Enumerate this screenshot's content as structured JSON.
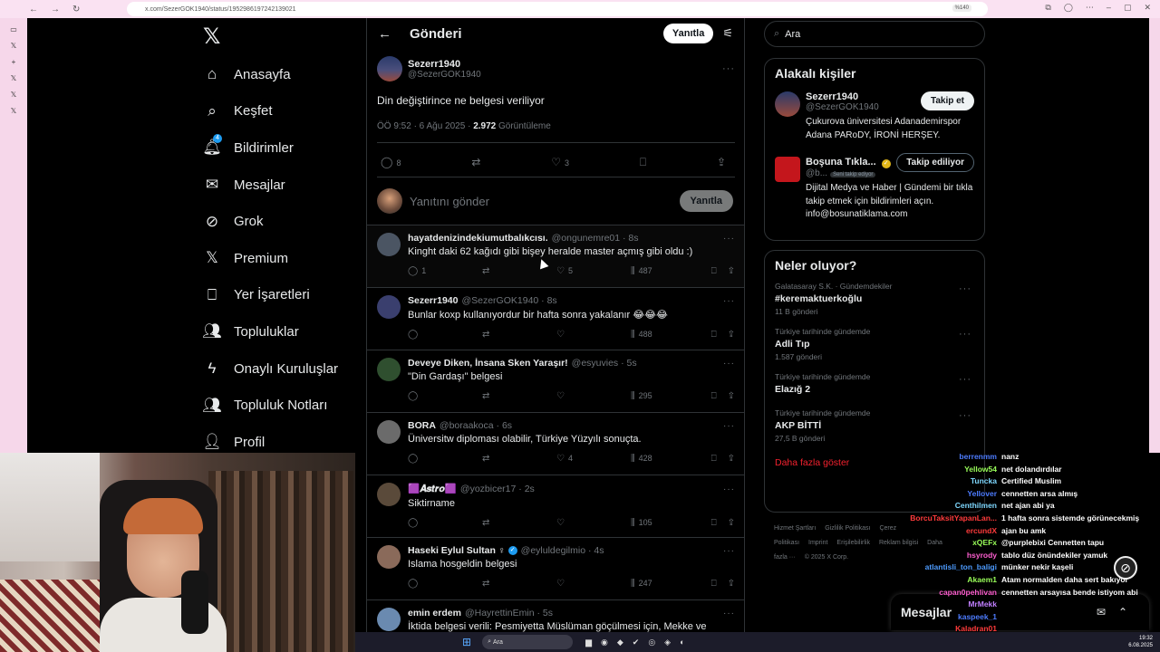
{
  "browser": {
    "url": "x.com/SezerGOK1940/status/1952986197242139021",
    "zoom": "%140"
  },
  "colors": {
    "accent": "#1d9bf0",
    "danger": "#f4212e",
    "bg": "#000000",
    "border": "#2f3336",
    "muted": "#71767b"
  },
  "nav": {
    "items": [
      {
        "label": "Anasayfa",
        "icon": "home-icon",
        "glyph": "⌂"
      },
      {
        "label": "Keşfet",
        "icon": "search-icon",
        "glyph": "⌕"
      },
      {
        "label": "Bildirimler",
        "icon": "bell-icon",
        "glyph": "🔔︎",
        "badge": "4"
      },
      {
        "label": "Mesajlar",
        "icon": "mail-icon",
        "glyph": "✉"
      },
      {
        "label": "Grok",
        "icon": "grok-icon",
        "glyph": "⊘"
      },
      {
        "label": "Premium",
        "icon": "x-logo-icon",
        "glyph": "𝕏"
      },
      {
        "label": "Yer İşaretleri",
        "icon": "bookmark-icon",
        "glyph": "⎕"
      },
      {
        "label": "Topluluklar",
        "icon": "communities-icon",
        "glyph": "👥︎"
      },
      {
        "label": "Onaylı Kuruluşlar",
        "icon": "lightning-icon",
        "glyph": "ϟ"
      },
      {
        "label": "Topluluk Notları",
        "icon": "notes-icon",
        "glyph": "👥︎"
      },
      {
        "label": "Profil",
        "icon": "person-icon",
        "glyph": "👤︎"
      }
    ]
  },
  "header": {
    "title": "Gönderi",
    "reply_label": "Yanıtla"
  },
  "main_tweet": {
    "name": "Sezerr1940",
    "handle": "@SezerGOK1940",
    "text": "Din değiştirince ne belgesi veriliyor",
    "time": "ÖÖ 9:52 · 6 Ağu 2025 · ",
    "views": "2.972",
    "views_label": " Görüntüleme",
    "replies": "8",
    "likes": "3"
  },
  "composer": {
    "placeholder": "Yanıtını gönder",
    "button": "Yanıtla"
  },
  "replies": [
    {
      "name": "hayatdenizindekiumutbalıkcısı.",
      "handle": "@ongunemre01 · 8s",
      "text": "Kinght daki 62 kağıdı gibi bişey heralde master açmış gibi oldu :)",
      "replies": "1",
      "likes": "5",
      "views": "487",
      "avatar": "#4b5563"
    },
    {
      "name": "Sezerr1940",
      "handle": "@SezerGOK1940 · 8s",
      "text": "Bunlar koxp kullanıyordur bir hafta sonra yakalanır 😂😂😂",
      "replies": "",
      "likes": "",
      "views": "488",
      "avatar": "#3a3f6e"
    },
    {
      "name": "Deveye Diken, İnsana Sken Yaraşır!",
      "handle": "@esyuvies · 5s",
      "text": "\"Din Gardaşı\" belgesi",
      "replies": "",
      "likes": "",
      "views": "295",
      "avatar": "#2f4f2f"
    },
    {
      "name": "BORA",
      "handle": "@boraakoca · 6s",
      "text": "Üniversitw diploması olabilir, Türkiye Yüzyılı sonuçta.",
      "replies": "",
      "likes": "4",
      "views": "428",
      "avatar": "#6b6b6b"
    },
    {
      "name": "🟪𝑨𝒔𝒕𝒓𝒐🟪",
      "handle": "@yozbicer17 · 2s",
      "text": "Siktirname",
      "replies": "",
      "likes": "",
      "views": "105",
      "avatar": "#5a4a3a"
    },
    {
      "name": "Haseki Eylul Sultan ♀",
      "handle": "@eyluldegilmio · 4s",
      "text": "Islama hosgeldin belgesi",
      "replies": "",
      "likes": "",
      "views": "247",
      "avatar": "#8a6a5a",
      "verified": true
    },
    {
      "name": "emin erdem",
      "handle": "@HayrettinEmin · 5s",
      "text": "İktida belgesi verili: Pesmiyetta Müslüman göçülmesi için, Mekke ve",
      "replies": "",
      "likes": "",
      "views": "",
      "avatar": "#6a8ab0"
    }
  ],
  "search": {
    "placeholder": "Ara"
  },
  "related": {
    "title": "Alakalı kişiler",
    "people": [
      {
        "name": "Sezerr1940",
        "handle": "@SezerGOK1940",
        "bio": "Çukurova üniversitesi Adanademirspor Adana PARoDY, İRONİ HERŞEY.",
        "button": "Takip et"
      },
      {
        "name": "Boşuna Tıkla...",
        "handle": "@b...",
        "follows_you": "Seni takip ediyor",
        "bio": "Dijital Medya ve Haber | Gündemi bir tıkla takip etmek için bildirimleri açın. info@bosunatiklama.com",
        "button": "Takip ediliyor"
      }
    ]
  },
  "trends": {
    "title": "Neler oluyor?",
    "items": [
      {
        "category": "Galatasaray S.K. · Gündemdekiler",
        "topic": "#keremaktuerkoğlu",
        "count": "11 B gönderi"
      },
      {
        "category": "Türkiye tarihinde gündemde",
        "topic": "Adli Tıp",
        "count": "1.587 gönderi"
      },
      {
        "category": "Türkiye tarihinde gündemde",
        "topic": "Elazığ 2",
        "count": ""
      },
      {
        "category": "Türkiye tarihinde gündemde",
        "topic": "AKP BİTTİ",
        "count": "27,5 B gönderi"
      }
    ],
    "show_more": "Daha fazla göster"
  },
  "footer": [
    "Hizmet Şartları",
    "Gizlilik Politikası",
    "Çerez Politikası",
    "Imprint",
    "Erişilebilirlik",
    "Reklam bilgisi",
    "Daha fazla ···",
    "© 2025 X Corp."
  ],
  "messages_dock": {
    "title": "Mesajlar"
  },
  "chat": [
    {
      "user": "berrenmm",
      "msg": "nanz",
      "color": "#4d7cff"
    },
    {
      "user": "Yellow54",
      "msg": "net dolandırdılar",
      "color": "#9aff5a"
    },
    {
      "user": "Tuncka",
      "msg": "Certified Muslim",
      "color": "#7fd8ff"
    },
    {
      "user": "Yellover",
      "msg": "cennetten arsa almış",
      "color": "#4d7cff"
    },
    {
      "user": "Centhilmen",
      "msg": "net ajan abi ya",
      "color": "#7fd8ff"
    },
    {
      "user": "BorcuTaksitYapanLan...",
      "msg": "1 hafta sonra sistemde görünecekmiş",
      "color": "#ff3b3b"
    },
    {
      "user": "ercundX",
      "msg": "ajan bu amk",
      "color": "#ff3b3b"
    },
    {
      "user": "xQEFx",
      "msg": "@purplebixi Cennetten tapu",
      "color": "#9aff5a"
    },
    {
      "user": "hsyrody",
      "msg": "tablo düz önündekiler yamuk",
      "color": "#ff5fd0"
    },
    {
      "user": "atlantisli_ton_baligi",
      "msg": "münker nekir kaşeli",
      "color": "#4d9bff"
    },
    {
      "user": "Akaem1",
      "msg": "Atam normalden daha sert bakıyor",
      "color": "#9aff5a"
    },
    {
      "user": "capan0pehlivan",
      "msg": "cennetten arsayısa bende istiyom abi",
      "color": "#ff5fd0"
    },
    {
      "user": "MrMekk",
      "msg": "",
      "color": "#c07fff"
    },
    {
      "user": "",
      "msg": "",
      "color": "#fff"
    },
    {
      "user": "kaspeek_1",
      "msg": "",
      "color": "#4d7cff"
    },
    {
      "user": "Kaladran01",
      "msg": "",
      "color": "#ff3b3b"
    }
  ],
  "taskbar": {
    "search": "Ara",
    "time": "19:32",
    "date": "6.08.2025"
  }
}
